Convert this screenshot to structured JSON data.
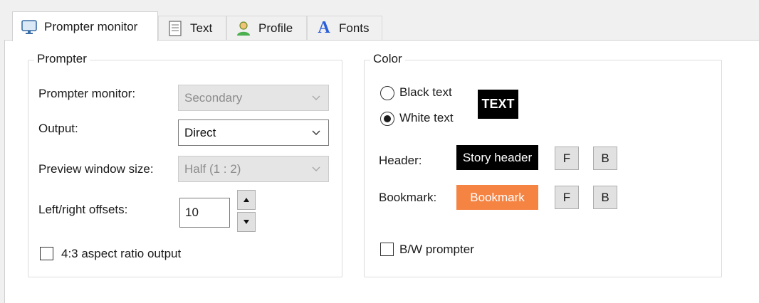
{
  "tabs": [
    {
      "label": "Prompter monitor",
      "icon": "monitor-icon",
      "active": true
    },
    {
      "label": "Text",
      "icon": "document-icon",
      "active": false
    },
    {
      "label": "Profile",
      "icon": "user-icon",
      "active": false
    },
    {
      "label": "Fonts",
      "icon": "font-icon",
      "active": false
    }
  ],
  "prompter": {
    "title": "Prompter",
    "monitor_label": "Prompter monitor:",
    "monitor_value": "Secondary",
    "output_label": "Output:",
    "output_value": "Direct",
    "preview_label": "Preview window size:",
    "preview_value": "Half (1 : 2)",
    "offsets_label": "Left/right offsets:",
    "offsets_value": "10",
    "aspect_label": "4:3 aspect ratio output",
    "aspect_checked": false
  },
  "color": {
    "title": "Color",
    "black_text_label": "Black text",
    "white_text_label": "White text",
    "selected": "White text",
    "preview_text": "TEXT",
    "header_label": "Header:",
    "header_sample": "Story header",
    "bookmark_label": "Bookmark:",
    "bookmark_sample": "Bookmark",
    "f_label": "F",
    "b_label": "B",
    "bw_label": "B/W prompter",
    "bw_checked": false,
    "header_bg": "#000000",
    "bookmark_bg": "#f58443"
  }
}
